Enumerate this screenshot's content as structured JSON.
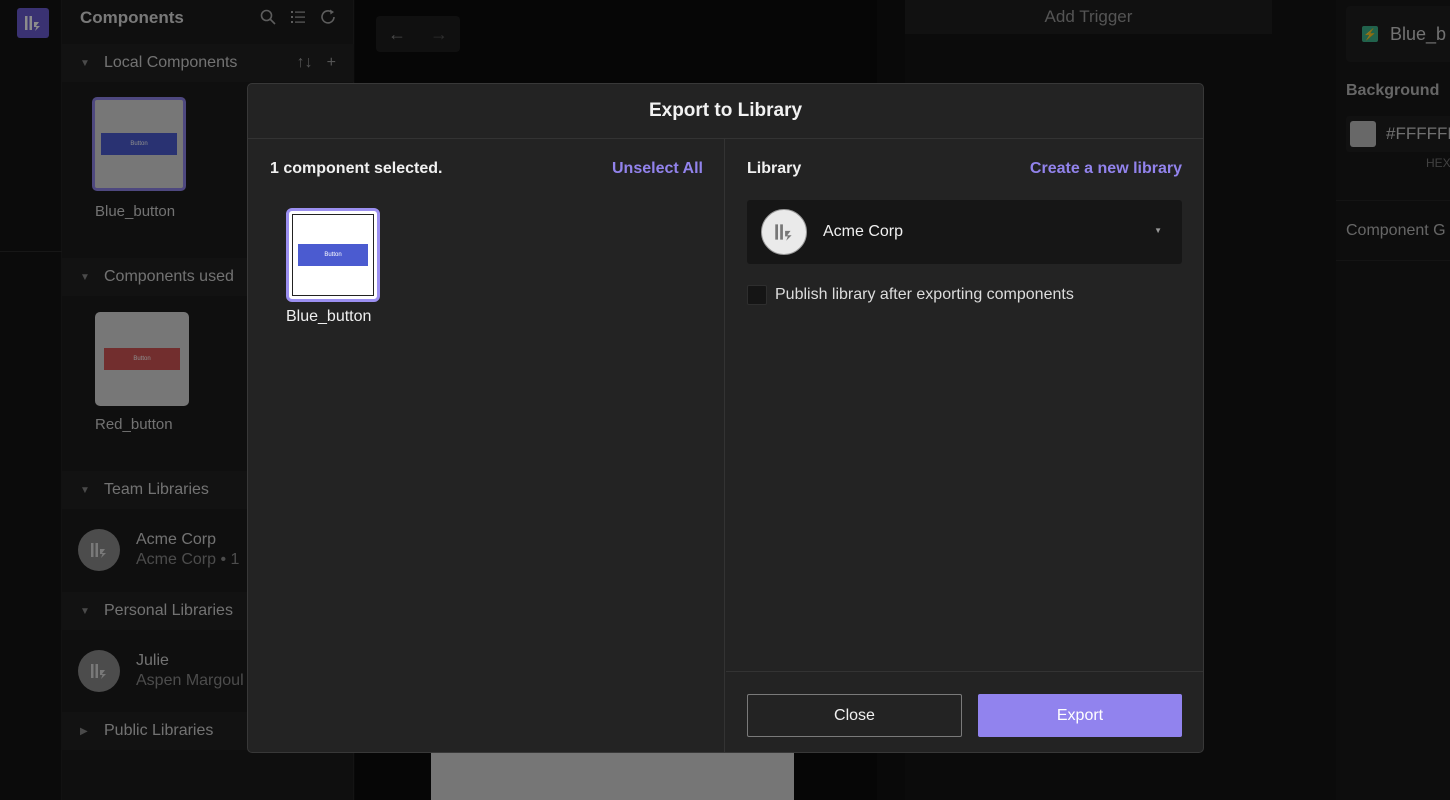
{
  "colors": {
    "accent": "#9283ec",
    "export_button": "#9183ee",
    "blue_button": "#4b5bd0",
    "red_button": "#d05555"
  },
  "components_panel": {
    "title": "Components",
    "icons": [
      "search-icon",
      "list-icon",
      "refresh-icon"
    ],
    "local_section": {
      "title": "Local Components",
      "items": [
        {
          "label": "Blue_button",
          "thumb_text": "Button"
        }
      ]
    },
    "used_section": {
      "title": "Components used",
      "items": [
        {
          "label": "Red_button",
          "thumb_text": "Button"
        }
      ]
    },
    "team_section": {
      "title": "Team Libraries",
      "items": [
        {
          "name": "Acme Corp",
          "sub": "Acme Corp • 1"
        }
      ]
    },
    "personal_section": {
      "title": "Personal Libraries",
      "items": [
        {
          "name": "Julie",
          "sub": "Aspen Margoul"
        }
      ]
    },
    "public_section": {
      "title": "Public Libraries"
    }
  },
  "trigger_panel": {
    "add_trigger_label": "Add Trigger"
  },
  "right_panel": {
    "component_name": "Blue_b",
    "background_label": "Background",
    "color_value": "#FFFFFF",
    "color_mode": "HEX",
    "group_label": "Component G"
  },
  "modal": {
    "title": "Export to Library",
    "selected_count_text": "1 component selected.",
    "unselect_all_label": "Unselect All",
    "selected_item": {
      "label": "Blue_button",
      "thumb_text": "Button"
    },
    "library_label": "Library",
    "create_library_label": "Create a new library",
    "selected_library": "Acme Corp",
    "publish_label": "Publish library after exporting components",
    "publish_checked": false,
    "close_label": "Close",
    "export_label": "Export"
  }
}
